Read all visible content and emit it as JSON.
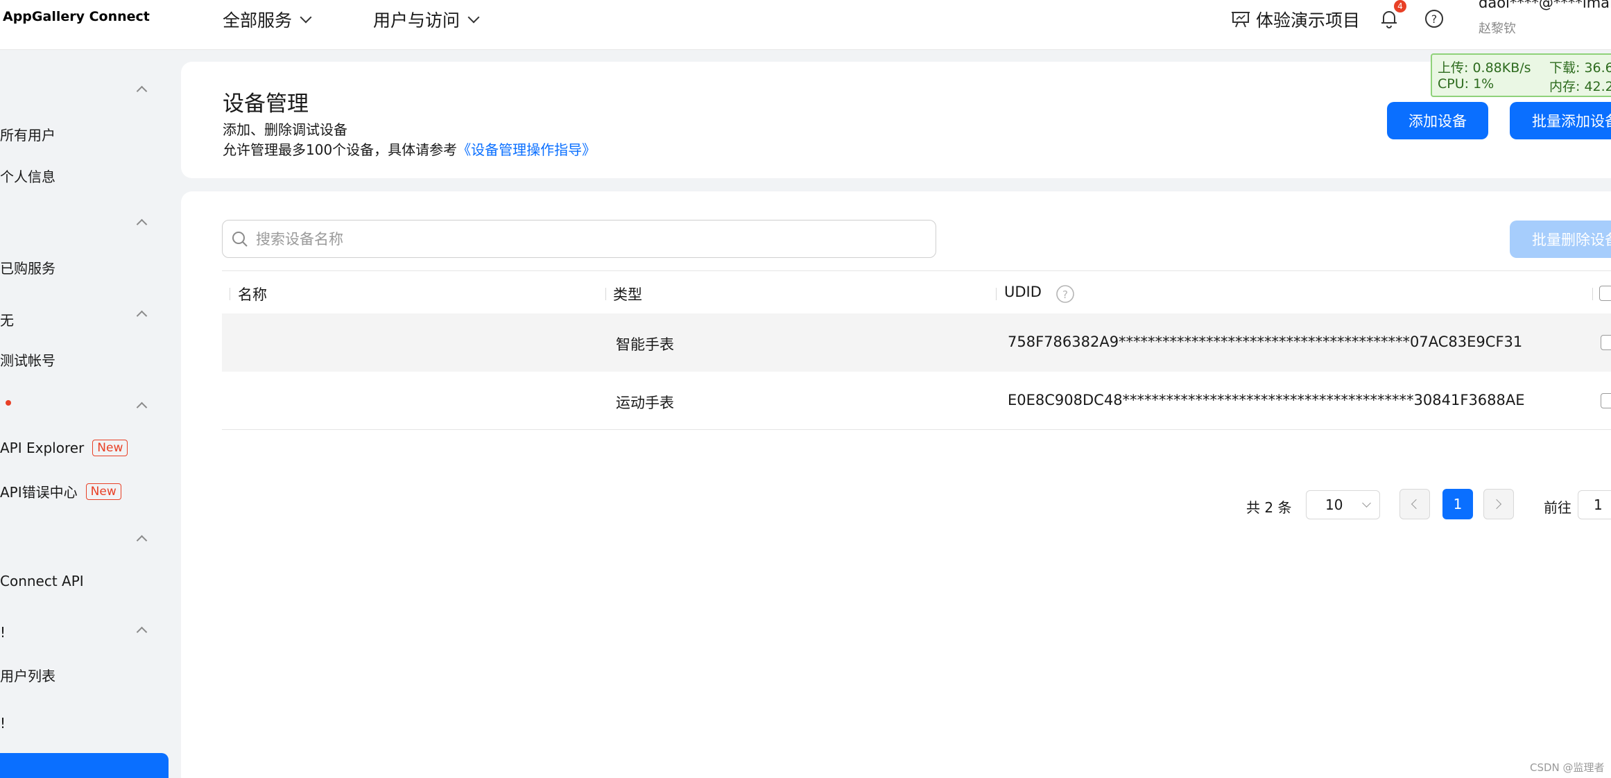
{
  "header": {
    "brand": "AppGallery Connect",
    "nav": [
      {
        "label": "全部服务"
      },
      {
        "label": "用户与访问"
      }
    ],
    "demo_label": "体验演示项目",
    "notification_count": "4",
    "user_email": "daol****@****lmail",
    "user_name": "赵黎钦"
  },
  "sidebar": {
    "groups": [
      {
        "label": "",
        "items": [
          {
            "label": "所有用户"
          },
          {
            "label": "个人信息"
          }
        ]
      },
      {
        "label": "",
        "items": [
          {
            "label": "已购服务"
          }
        ]
      },
      {
        "label": "无",
        "items": [
          {
            "label": "测试帐号"
          }
        ]
      },
      {
        "label": "",
        "items": [
          {
            "label": "API Explorer",
            "badge": "New"
          },
          {
            "label": "API错误中心",
            "badge": "New"
          }
        ]
      },
      {
        "label": "",
        "items": [
          {
            "label": "Connect API"
          }
        ]
      },
      {
        "label": "!",
        "items": [
          {
            "label": "用户列表"
          }
        ]
      },
      {
        "label": "!",
        "items": []
      }
    ]
  },
  "netmon": {
    "upload": "上传: 0.88KB/s",
    "download": "下载: 36.6",
    "cpu": "CPU: 1%",
    "memory": "内存: 42.2"
  },
  "page": {
    "title": "设备管理",
    "desc_line1": "添加、删除调试设备",
    "desc_line2": "允许管理最多100个设备，具体请参考",
    "desc_link": "《设备管理操作指导》",
    "add_button": "添加设备",
    "batch_add_button": "批量添加设备"
  },
  "search": {
    "placeholder": "搜索设备名称"
  },
  "batch_delete_button": "批量删除设备",
  "table": {
    "columns": [
      "名称",
      "类型",
      "UDID"
    ],
    "rows": [
      {
        "name": "",
        "type": "智能手表",
        "udid": "758F786382A9****************************************07AC83E9CF31"
      },
      {
        "name": "",
        "type": "运动手表",
        "udid": "E0E8C908DC48****************************************30841F3688AE"
      }
    ]
  },
  "pagination": {
    "total": "共 2 条",
    "page_size": "10",
    "current": "1",
    "goto_label": "前往",
    "goto_value": "1"
  },
  "watermark": "CSDN @监理者",
  "colors": {
    "primary": "#0a6fff",
    "primary_disabled": "#a6cdfc",
    "badge_red": "#e84026"
  }
}
